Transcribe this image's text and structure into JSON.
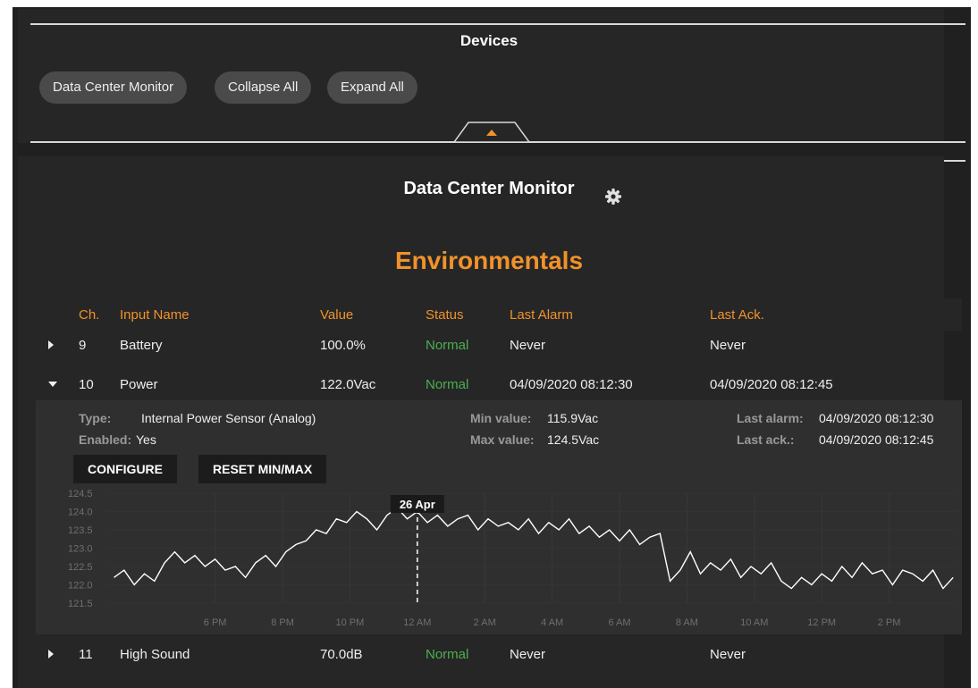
{
  "devices_panel": {
    "title": "Devices",
    "buttons": [
      "Data Center Monitor",
      "Collapse All",
      "Expand All"
    ]
  },
  "monitor": {
    "title": "Data Center Monitor",
    "section_title": "Environmentals"
  },
  "table": {
    "headers": {
      "ch": "Ch.",
      "name": "Input Name",
      "value": "Value",
      "status": "Status",
      "last_alarm": "Last Alarm",
      "last_ack": "Last Ack."
    },
    "rows": [
      {
        "ch": "9",
        "name": "Battery",
        "value": "100.0%",
        "status": "Normal",
        "last_alarm": "Never",
        "last_ack": "Never"
      },
      {
        "ch": "10",
        "name": "Power",
        "value": "122.0Vac",
        "status": "Normal",
        "last_alarm": "04/09/2020 08:12:30",
        "last_ack": "04/09/2020 08:12:45"
      },
      {
        "ch": "11",
        "name": "High Sound",
        "value": "70.0dB",
        "status": "Normal",
        "last_alarm": "Never",
        "last_ack": "Never"
      }
    ]
  },
  "detail": {
    "type_label": "Type:",
    "type_value": "Internal Power Sensor (Analog)",
    "enabled_label": "Enabled:",
    "enabled_value": "Yes",
    "min_label": "Min value:",
    "min_value": "115.9Vac",
    "max_label": "Max value:",
    "max_value": "124.5Vac",
    "last_alarm_label": "Last alarm:",
    "last_alarm_value": "04/09/2020 08:12:30",
    "last_ack_label": "Last ack.:",
    "last_ack_value": "04/09/2020 08:12:45",
    "configure_label": "CONFIGURE",
    "reset_label": "RESET MIN/MAX"
  },
  "colors": {
    "accent": "#f0922b",
    "ok": "#4caf50",
    "line": "#ffffff"
  },
  "chart_data": {
    "type": "line",
    "y_ticks": [
      "124.5",
      "124.0",
      "123.5",
      "123.0",
      "122.5",
      "122.0",
      "121.5"
    ],
    "ylim": [
      121.5,
      124.5
    ],
    "x_ticks": [
      "6 PM",
      "8 PM",
      "10 PM",
      "12 AM",
      "2 AM",
      "4 AM",
      "6 AM",
      "8 AM",
      "10 AM",
      "12 PM",
      "2 PM"
    ],
    "cursor_label": "26 Apr",
    "cursor_tick": "12 AM",
    "series": [
      {
        "x_hours": [
          15.0,
          15.3,
          15.6,
          15.9,
          16.2,
          16.5,
          16.8,
          17.1,
          17.4,
          17.7,
          18.0,
          18.3,
          18.6,
          18.9,
          19.2,
          19.5,
          19.8,
          20.1,
          20.4,
          20.7,
          21.0,
          21.3,
          21.6,
          21.9,
          22.2,
          22.5,
          22.8,
          23.1,
          23.4,
          23.7,
          24.0,
          24.3,
          24.6,
          24.9,
          25.2,
          25.5,
          25.8,
          26.1,
          26.4,
          26.7,
          27.0,
          27.3,
          27.6,
          27.9,
          28.2,
          28.5,
          28.8,
          29.1,
          29.4,
          29.7,
          30.0,
          30.3,
          30.6,
          30.9,
          31.2,
          31.5,
          31.8,
          32.1,
          32.4,
          32.7,
          33.0,
          33.3,
          33.6,
          33.9,
          34.2,
          34.5,
          34.8,
          35.1,
          35.4,
          35.7,
          36.0,
          36.3,
          36.6,
          36.9,
          37.2,
          37.5,
          37.8,
          38.1,
          38.4,
          38.7,
          39.0,
          39.3,
          39.6,
          39.9
        ],
        "values": [
          122.2,
          122.4,
          122.0,
          122.3,
          122.1,
          122.6,
          122.9,
          122.6,
          122.8,
          122.5,
          122.7,
          122.4,
          122.5,
          122.2,
          122.6,
          122.8,
          122.5,
          122.9,
          123.1,
          123.2,
          123.5,
          123.4,
          123.8,
          123.7,
          124.0,
          123.8,
          123.5,
          123.9,
          124.1,
          123.8,
          124.0,
          123.7,
          123.9,
          123.6,
          123.8,
          123.9,
          123.5,
          123.8,
          123.6,
          123.7,
          123.5,
          123.8,
          123.4,
          123.7,
          123.5,
          123.8,
          123.4,
          123.6,
          123.3,
          123.5,
          123.2,
          123.5,
          123.1,
          123.3,
          123.4,
          122.1,
          122.4,
          122.9,
          122.3,
          122.6,
          122.4,
          122.7,
          122.2,
          122.5,
          122.3,
          122.6,
          122.1,
          121.9,
          122.2,
          122.0,
          122.3,
          122.1,
          122.5,
          122.2,
          122.6,
          122.3,
          122.4,
          122.0,
          122.4,
          122.3,
          122.1,
          122.4,
          121.9,
          122.2
        ]
      }
    ]
  }
}
